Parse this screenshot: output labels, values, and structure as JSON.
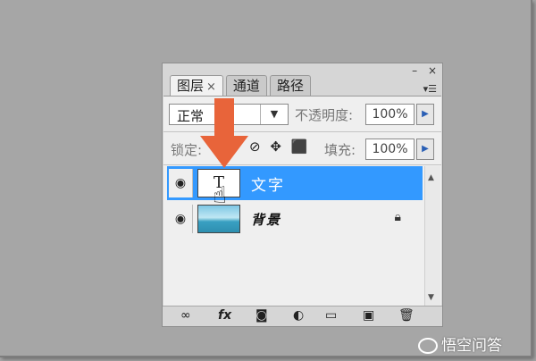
{
  "panel": {
    "window_buttons": [
      "–",
      "×"
    ],
    "tabs": [
      {
        "label": "图层",
        "close": "×"
      },
      {
        "label": "通道"
      },
      {
        "label": "路径"
      }
    ],
    "menu_icon": "panel-menu-icon",
    "blend_mode": "正常",
    "opacity_label": "不透明度:",
    "opacity_value": "100%",
    "lock_label": "锁定:",
    "fill_label": "填充:",
    "fill_value": "100%",
    "layers": [
      {
        "name": "文字",
        "type": "text",
        "selected": true,
        "thumb": "T"
      },
      {
        "name": "背景",
        "type": "image",
        "selected": false,
        "locked": true
      }
    ],
    "bottom_icons": [
      "link-icon",
      "fx-icon",
      "mask-icon",
      "adjustment-icon",
      "folder-icon",
      "new-layer-icon",
      "trash-icon"
    ],
    "fx_label": "fx"
  },
  "watermark": "悟空问答",
  "colors": {
    "selection": "#3399ff",
    "arrow": "#e8643a",
    "background": "#a6a6a6"
  }
}
